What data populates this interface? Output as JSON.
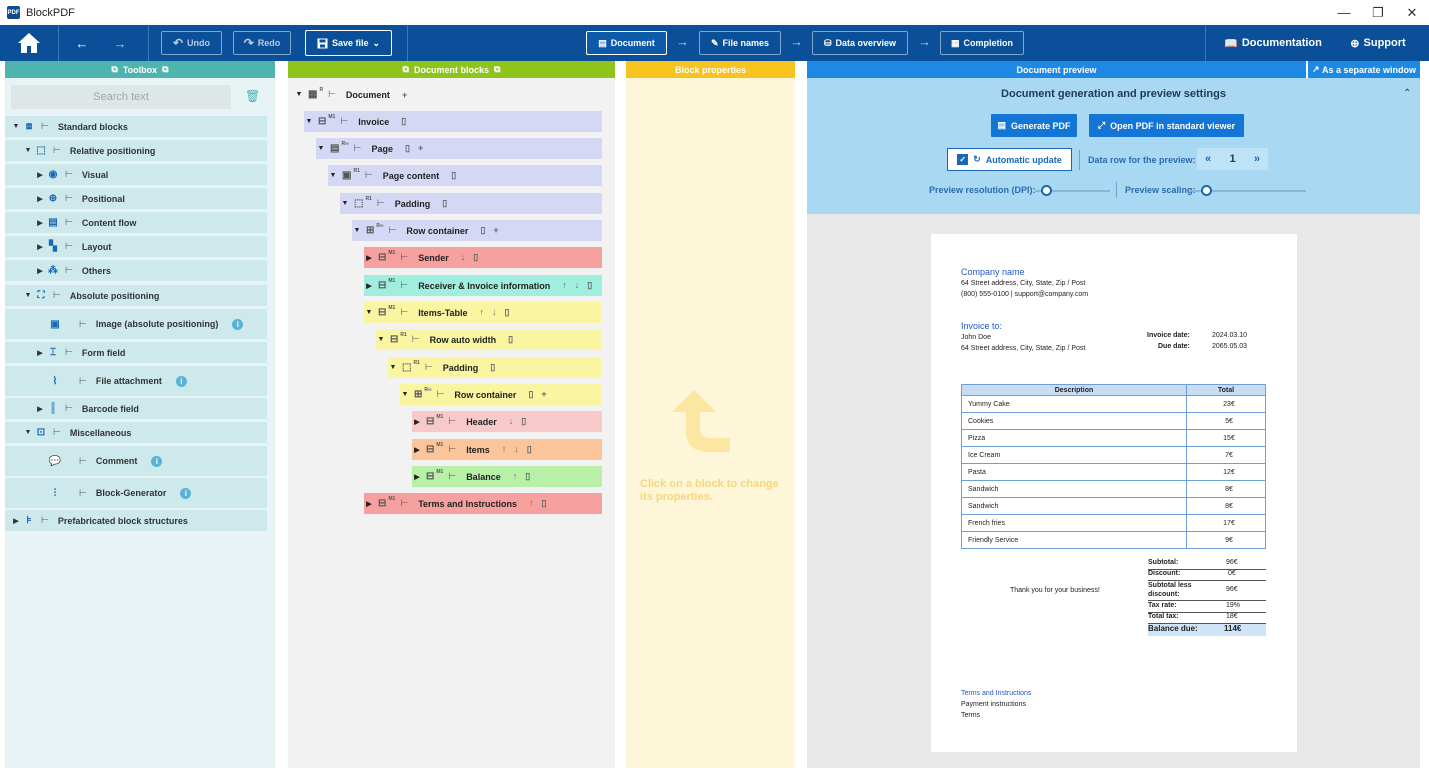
{
  "window": {
    "app_icon": "PDF",
    "title": "BlockPDF",
    "minimize": "—",
    "maximize": "❐",
    "close": "✕"
  },
  "toolbar": {
    "undo": "Undo",
    "redo": "Redo",
    "save_file": "Save file",
    "steps": [
      "Document",
      "File names",
      "Data overview",
      "Completion"
    ],
    "documentation": "Documentation",
    "support": "Support"
  },
  "panels": {
    "toolbox": "Toolbox",
    "document_blocks": "Document blocks",
    "block_properties": "Block properties",
    "document_preview": "Document preview",
    "separate_window": "As a separate window"
  },
  "toolbox": {
    "search_placeholder": "Search text",
    "items": [
      "Standard blocks",
      "Relative positioning",
      "Visual",
      "Positional",
      "Content flow",
      "Layout",
      "Others",
      "Absolute positioning",
      "Image (absolute positioning)",
      "Form field",
      "File attachment",
      "Barcode field",
      "Miscellaneous",
      "Comment",
      "Block-Generator",
      "Prefabricated block structures"
    ]
  },
  "blocks": [
    "Document",
    "Invoice",
    "Page",
    "Page content",
    "Padding",
    "Row container",
    "Sender",
    "Receiver & Invoice information",
    "Items-Table",
    "Row auto width",
    "Padding",
    "Row container",
    "Header",
    "Items",
    "Balance",
    "Terms and Instructions"
  ],
  "block_properties": {
    "hint": "Click on a block to change its properties."
  },
  "preview": {
    "settings_title": "Document generation and preview settings",
    "generate_pdf": "Generate PDF",
    "open_pdf": "Open PDF in standard viewer",
    "auto_update": "Automatic update",
    "data_row_label": "Data row for the preview:",
    "data_row_value": "1",
    "resolution_label": "Preview resolution (DPI):",
    "scaling_label": "Preview scaling:"
  },
  "invoice": {
    "company": "Company name",
    "address": "64 Street address, City, State, Zip / Post",
    "contact": "(800) 555-0100 | support@company.com",
    "invoice_to": "Invoice to:",
    "client_name": "John Doe",
    "client_address": "64 Street address, City, State, Zip / Post",
    "invoice_date_label": "Invoice date:",
    "invoice_date": "2024.03.10",
    "due_date_label": "Due date:",
    "due_date": "2065.05.03",
    "col_description": "Description",
    "col_total": "Total",
    "rows": [
      {
        "d": "Yummy Cake",
        "t": "23€"
      },
      {
        "d": "Cookies",
        "t": "5€"
      },
      {
        "d": "Pizza",
        "t": "15€"
      },
      {
        "d": "Ice Cream",
        "t": "7€"
      },
      {
        "d": "Pasta",
        "t": "12€"
      },
      {
        "d": "Sandwich",
        "t": "8€"
      },
      {
        "d": "Sandwich",
        "t": "8€"
      },
      {
        "d": "French fries",
        "t": "17€"
      },
      {
        "d": "Friendly Service",
        "t": "9€"
      }
    ],
    "thanks": "Thank you for your business!",
    "subtotal_label": "Subtotal:",
    "subtotal": "96€",
    "discount_label": "Discount:",
    "discount": "0€",
    "subtotal_less_label": "Subtotal less discount:",
    "subtotal_less": "96€",
    "tax_rate_label": "Tax rate:",
    "tax_rate": "19%",
    "total_tax_label": "Total tax:",
    "total_tax": "18€",
    "balance_label": "Balance due:",
    "balance": "114€",
    "terms_title": "Terms and Instructions",
    "terms_1": "Payment instructions",
    "terms_2": "Terms"
  },
  "colors": {
    "accent": "#0a4f97",
    "toolbox_head": "#4fb3ae",
    "blocks_head": "#8fc41d",
    "props_head": "#f6c31f",
    "preview_head": "#1e88e5"
  }
}
